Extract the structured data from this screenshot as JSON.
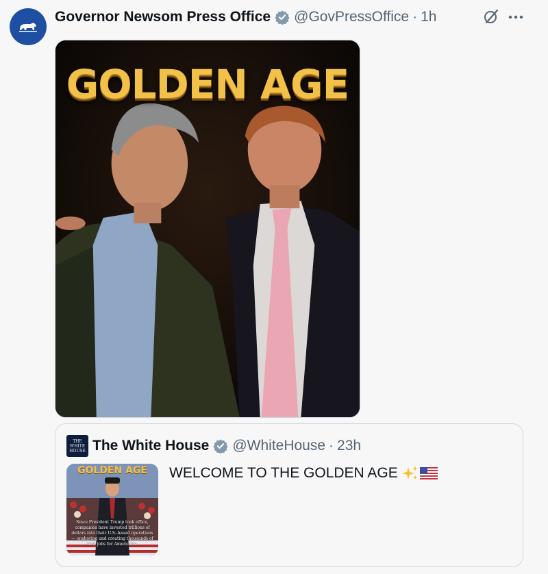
{
  "post": {
    "display_name": "Governor Newsom Press Office",
    "handle": "@GovPressOffice",
    "separator": "·",
    "time": "1h",
    "media_title": "GOLDEN AGE"
  },
  "quoted_post": {
    "display_name": "The White House",
    "handle": "@WhiteHouse",
    "separator": "·",
    "time": "23h",
    "avatar_text": [
      "THE",
      "WHITE",
      "HOUSE"
    ],
    "text": "WELCOME TO THE GOLDEN AGE",
    "emojis": [
      "sparkles",
      "us-flag"
    ],
    "thumbnail_title": "GOLDEN AGE",
    "thumbnail_caption": "Since President Trump took office, companies have invested trillions of dollars into their U.S.-based operations — onshoring and creating thousands of new jobs for Americans."
  },
  "icons": {
    "avatar": "bear-icon",
    "verified": "verified-badge-icon",
    "grok": "grok-icon",
    "more": "more-icon"
  },
  "colors": {
    "background": "#f7f7f8",
    "text_primary": "#0f1419",
    "text_secondary": "#536471",
    "verified_badge": "#829aab",
    "avatar_blue": "#1f4fa3",
    "gold": "#f2c14a"
  }
}
